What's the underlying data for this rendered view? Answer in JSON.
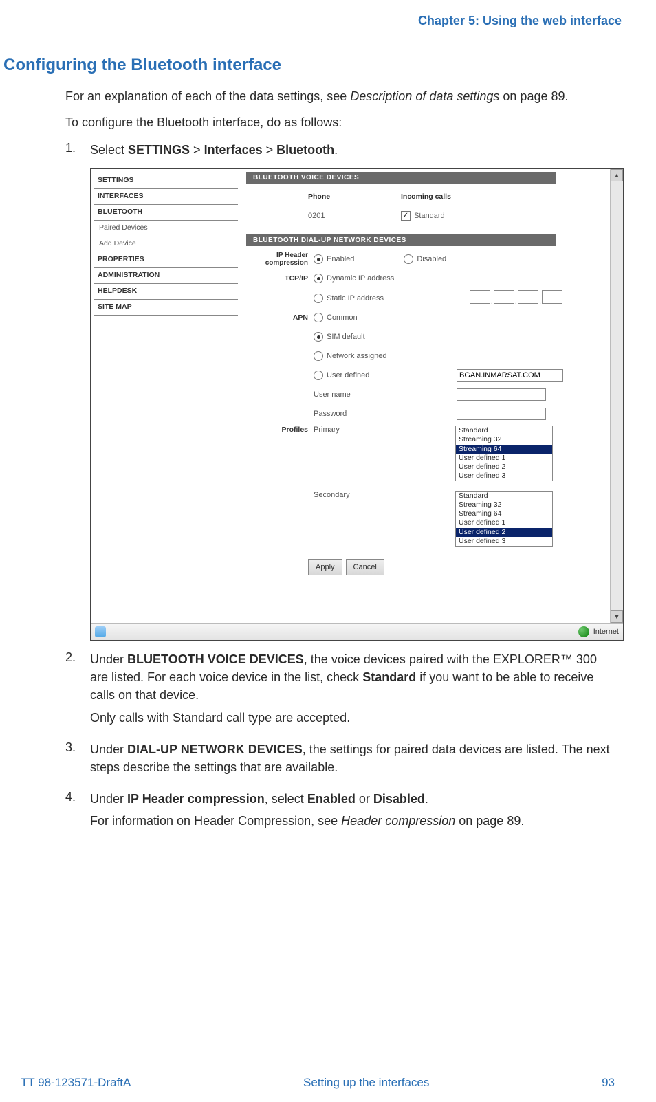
{
  "header": {
    "chapter": "Chapter 5: Using the web interface"
  },
  "title": "Configuring the Bluetooth interface",
  "intro1": "For an explanation of each of the data settings, see ",
  "intro1_ital": "Description of data settings",
  "intro1_suffix": " on page 89.",
  "intro2": "To configure the Bluetooth interface, do as follows:",
  "steps": {
    "s1": {
      "num": "1.",
      "pre": "Select ",
      "b1": "SETTINGS",
      "mid1": " > ",
      "b2": "Interfaces",
      "mid2": " > ",
      "b3": "Bluetooth",
      "end": "."
    },
    "s2": {
      "num": "2.",
      "pre": "Under ",
      "b1": "BLUETOOTH VOICE DEVICES",
      "txt1": ", the voice devices paired with the EXPLORER™ 300 are listed. For each voice device in the list, check ",
      "b2": "Standard",
      "txt2": " if you want to be able to receive calls on that device.",
      "line2": "Only calls with Standard call type are accepted."
    },
    "s3": {
      "num": "3.",
      "pre": "Under ",
      "b1": "DIAL-UP NETWORK DEVICES",
      "txt": ", the settings for paired data devices are listed. The next steps describe the settings that are available."
    },
    "s4": {
      "num": "4.",
      "pre": "Under ",
      "b1": "IP Header compression",
      "mid": ", select ",
      "b2": "Enabled",
      "or": " or ",
      "b3": "Disabled",
      "end": ".",
      "line2a": "For information on Header Compression, see ",
      "line2i": "Header compression",
      "line2b": " on page 89."
    }
  },
  "screenshot": {
    "sidebar": {
      "items": [
        "SETTINGS",
        "INTERFACES",
        "BLUETOOTH",
        "Paired Devices",
        "Add Device",
        "PROPERTIES",
        "ADMINISTRATION",
        "HELPDESK",
        "SITE MAP"
      ],
      "bold_indices": [
        0,
        1,
        2,
        5,
        6,
        7,
        8
      ]
    },
    "section1_title": "BLUETOOTH VOICE DEVICES",
    "voice": {
      "col_phone": "Phone",
      "col_incoming": "Incoming calls",
      "phone_value": "0201",
      "checkbox_label": "Standard",
      "checkbox_checked": true
    },
    "section2_title": "BLUETOOTH DIAL-UP NETWORK DEVICES",
    "dialup": {
      "ip_header_label": "IP Header compression",
      "enabled": "Enabled",
      "disabled": "Disabled",
      "ip_header_selected": "Enabled",
      "tcpip_label": "TCP/IP",
      "tcpip_dynamic": "Dynamic IP address",
      "tcpip_static": "Static IP address",
      "tcpip_selected": "Dynamic IP address",
      "apn_label": "APN",
      "apn_common": "Common",
      "apn_sim": "SIM default",
      "apn_network": "Network assigned",
      "apn_user": "User defined",
      "apn_selected": "SIM default",
      "apn_user_value": "BGAN.INMARSAT.COM",
      "username_label": "User name",
      "password_label": "Password",
      "profiles_label": "Profiles",
      "primary_label": "Primary",
      "secondary_label": "Secondary",
      "primary_options": [
        "Standard",
        "Streaming 32",
        "Streaming 64",
        "User defined 1",
        "User defined 2",
        "User defined 3"
      ],
      "primary_selected": "Streaming 64",
      "secondary_options": [
        "Standard",
        "Streaming 32",
        "Streaming 64",
        "User defined 1",
        "User defined 2",
        "User defined 3"
      ],
      "secondary_selected": "User defined 2",
      "apply": "Apply",
      "cancel": "Cancel"
    },
    "status": {
      "zone": "Internet"
    }
  },
  "footer": {
    "left": "TT 98-123571-DraftA",
    "center": "Setting up the interfaces",
    "right": "93"
  }
}
